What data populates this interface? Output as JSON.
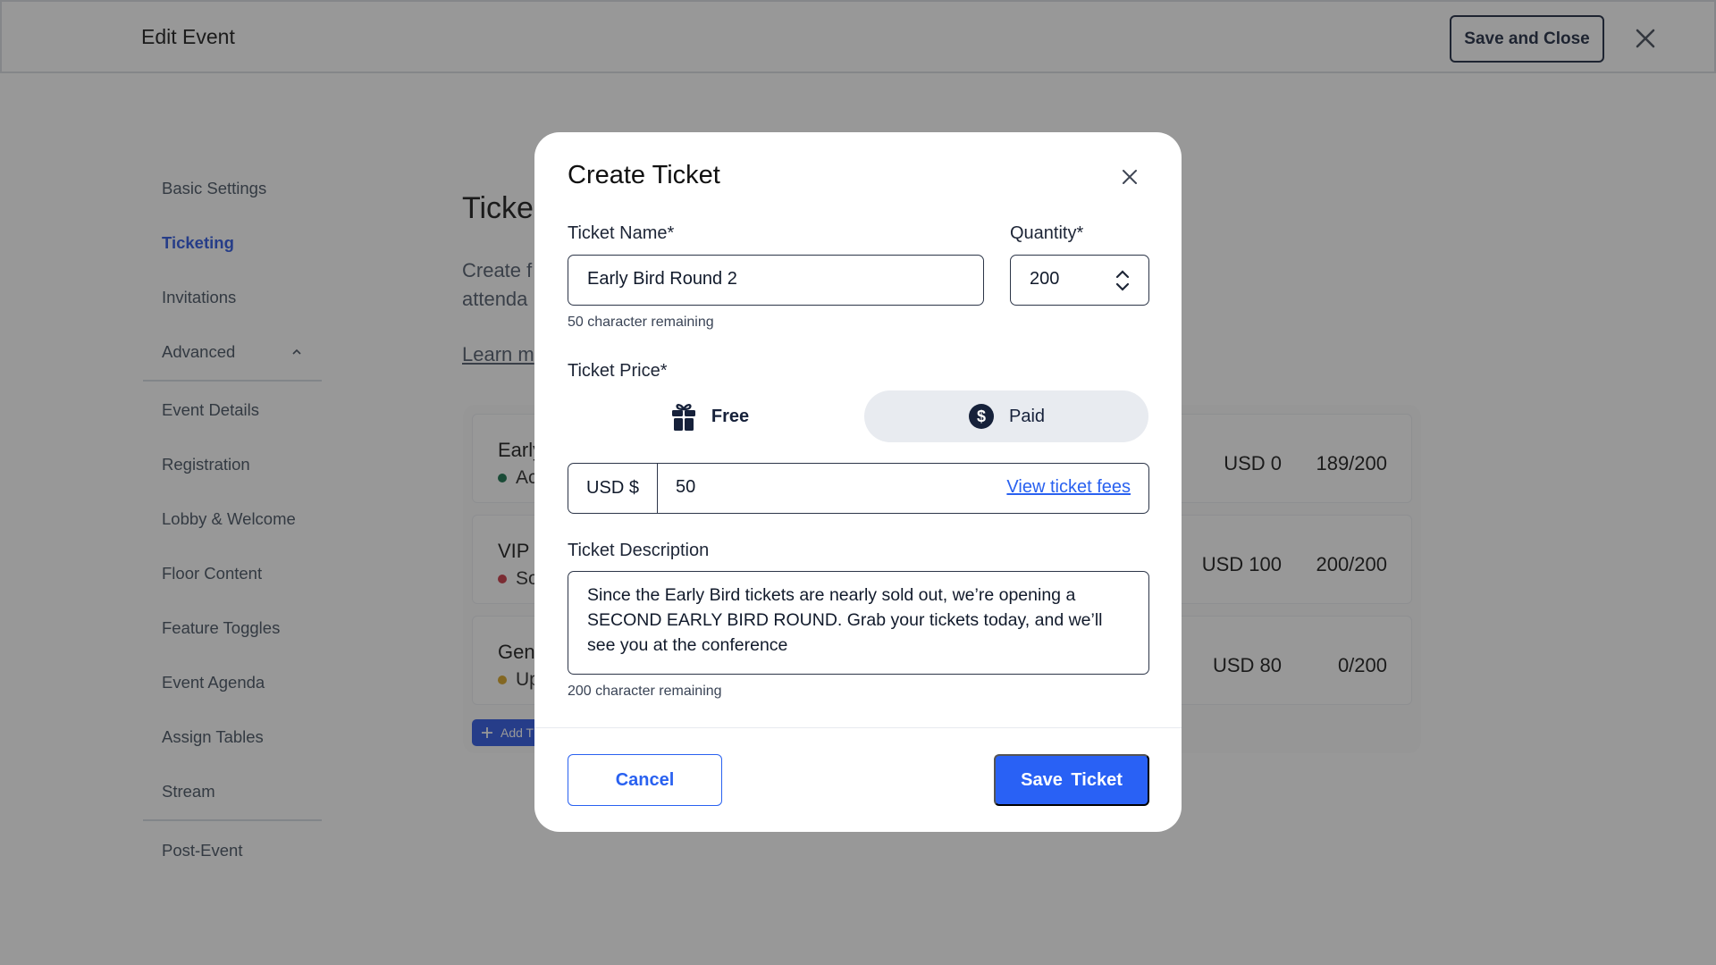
{
  "header": {
    "title": "Edit Event",
    "save_close_label": "Save and Close",
    "close_icon": "close-icon"
  },
  "sidebar": {
    "items": [
      {
        "label": "Basic Settings",
        "active": false
      },
      {
        "label": "Ticketing",
        "active": true
      },
      {
        "label": "Invitations",
        "active": false
      },
      {
        "label": "Advanced",
        "active": false,
        "expanded": true
      },
      {
        "label": "Event Details",
        "active": false
      },
      {
        "label": "Registration",
        "active": false
      },
      {
        "label": "Lobby & Welcome",
        "active": false
      },
      {
        "label": "Floor Content",
        "active": false
      },
      {
        "label": "Feature Toggles",
        "active": false
      },
      {
        "label": "Event Agenda",
        "active": false
      },
      {
        "label": "Assign Tables",
        "active": false
      },
      {
        "label": "Stream",
        "active": false
      },
      {
        "label": "Post-Event",
        "active": false
      }
    ]
  },
  "main": {
    "title_visible": "Ticke",
    "description_visible_line1": "Create f",
    "description_visible_line2": "attenda",
    "learn_more_visible": "Learn m",
    "tickets": [
      {
        "name_visible": "Early",
        "status_visible": "Ac",
        "status_color": "#0f6b45",
        "price": "USD 0",
        "quantity": "189/200"
      },
      {
        "name_visible": "VIP",
        "status_visible": "So",
        "status_color": "#c8303f",
        "price": "USD 100",
        "quantity": "200/200"
      },
      {
        "name_visible": "Gen",
        "status_visible": "Up",
        "status_color": "#d6a21d",
        "price": "USD 80",
        "quantity": "0/200"
      }
    ],
    "add_ticket_visible": "Add T"
  },
  "modal": {
    "title": "Create Ticket",
    "ticket_name_label": "Ticket Name*",
    "ticket_name_value": "Early Bird Round 2",
    "ticket_name_hint": "50 character remaining",
    "quantity_label": "Quantity*",
    "quantity_value": "200",
    "price_label": "Ticket Price*",
    "price_options": [
      {
        "label": "Free",
        "icon": "gift-icon",
        "selected": false
      },
      {
        "label": "Paid",
        "icon": "dollar-circle-icon",
        "selected": true
      }
    ],
    "currency": "USD $",
    "price_value": "50",
    "view_fees_label": "View ticket fees",
    "description_label": "Ticket Description",
    "description_value": "Since the Early Bird tickets are nearly sold out, we’re opening a SECOND EARLY BIRD ROUND. Grab your tickets today, and we’ll see you at the conference",
    "description_hint": "200 character remaining",
    "cancel_label": "Cancel",
    "save_label": "Save  Ticket"
  },
  "colors": {
    "accent": "#2961f5",
    "sidebar_active": "#2551e0",
    "text_dark": "#16213a"
  }
}
